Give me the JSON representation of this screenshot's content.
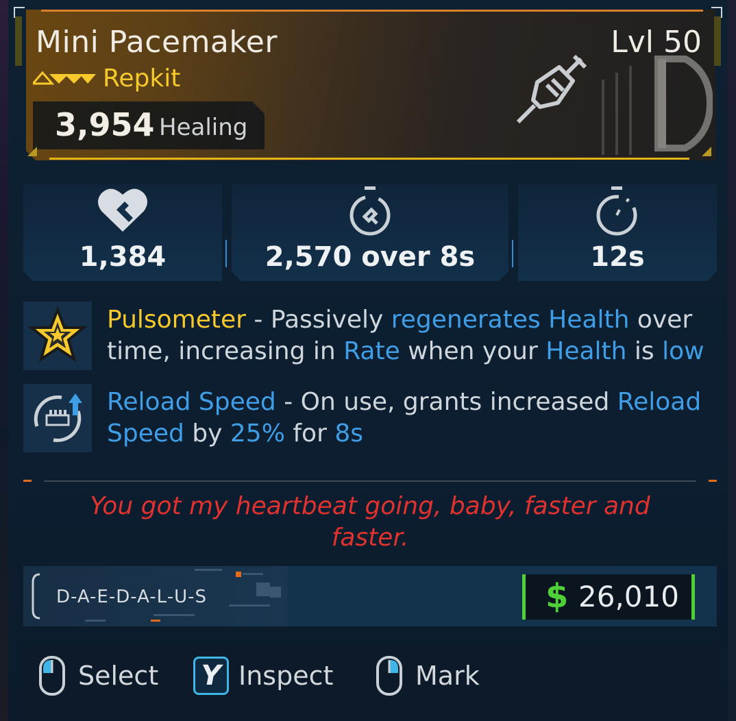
{
  "item": {
    "name": "Mini Pacemaker",
    "level": "Lvl 50",
    "type": "Repkit",
    "healing_value": "3,954",
    "healing_label": "Healing",
    "rarity_color": "#f6c92c",
    "icon": "syringe-icon"
  },
  "stats": [
    {
      "icon": "heart-heal-icon",
      "value": "1,384"
    },
    {
      "icon": "stopwatch-heal-icon",
      "value": "2,570 over 8s"
    },
    {
      "icon": "stopwatch-icon",
      "value": "12s"
    }
  ],
  "perks": [
    {
      "icon": "star-badge-icon",
      "name": "Pulsometer",
      "sep": " - Passively ",
      "k1": "regenerates Health",
      "t2": " over time, increasing in ",
      "k2": "Rate",
      "t3": " when your ",
      "k3": "Health",
      "t4": " is ",
      "k4": "low"
    },
    {
      "icon": "reload-ammo-icon",
      "name": "Reload Speed",
      "sep": " - On use, grants increased ",
      "k1": "Reload Speed",
      "t2": " by ",
      "k2": "25%",
      "t3": " for ",
      "k3": "8s"
    }
  ],
  "flavor_text": "You got my heartbeat going, baby, faster and faster.",
  "manufacturer": "D-A-E-D-A-L-U-S",
  "price": {
    "symbol": "$",
    "value": "26,010"
  },
  "controls": [
    {
      "icon": "mouse-left-icon",
      "label": "Select"
    },
    {
      "icon": "key-y-icon",
      "key": "Y",
      "label": "Inspect"
    },
    {
      "icon": "mouse-right-icon",
      "label": "Mark"
    }
  ],
  "colors": {
    "accent_gold": "#f6c92c",
    "keyword_blue": "#3f9ee6",
    "flavor_red": "#e0322e",
    "price_green": "#4fcf38"
  }
}
